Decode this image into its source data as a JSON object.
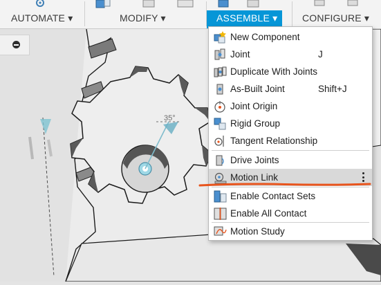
{
  "toolbar": {
    "automate_label": "AUTOMATE",
    "modify_label": "MODIFY",
    "assemble_label": "ASSEMBLE",
    "configure_label": "CONFIGURE",
    "caret": "▾"
  },
  "viewport": {
    "dimension_text": "35°"
  },
  "menu": {
    "items": [
      {
        "label": "New Component",
        "shortcut": "",
        "icon": "new-component-icon"
      },
      {
        "label": "Joint",
        "shortcut": "J",
        "icon": "joint-icon"
      },
      {
        "label": "Duplicate With Joints",
        "shortcut": "",
        "icon": "duplicate-joints-icon"
      },
      {
        "label": "As-Built Joint",
        "shortcut": "Shift+J",
        "icon": "as-built-joint-icon"
      },
      {
        "label": "Joint Origin",
        "shortcut": "",
        "icon": "joint-origin-icon"
      },
      {
        "label": "Rigid Group",
        "shortcut": "",
        "icon": "rigid-group-icon"
      },
      {
        "label": "Tangent Relationship",
        "shortcut": "",
        "icon": "tangent-relationship-icon"
      },
      {
        "label": "Drive Joints",
        "shortcut": "",
        "icon": "drive-joints-icon"
      },
      {
        "label": "Motion Link",
        "shortcut": "",
        "icon": "motion-link-icon"
      },
      {
        "label": "Enable Contact Sets",
        "shortcut": "",
        "icon": "enable-contact-sets-icon"
      },
      {
        "label": "Enable All Contact",
        "shortcut": "",
        "icon": "enable-all-contact-icon"
      },
      {
        "label": "Motion Study",
        "shortcut": "",
        "icon": "motion-study-icon"
      }
    ],
    "highlighted_item": "Motion Link"
  },
  "colors": {
    "accent": "#0696d7",
    "annotation": "#e8541c",
    "highlight": "#d9d9d9"
  }
}
